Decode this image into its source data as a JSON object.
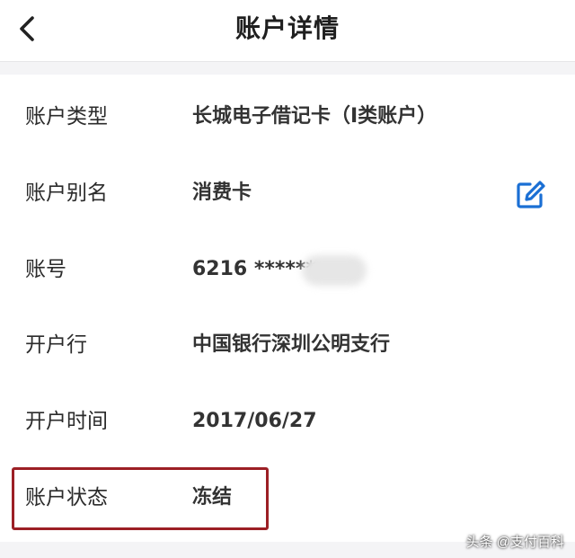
{
  "header": {
    "title": "账户详情",
    "back_icon": "chevron-left-icon"
  },
  "details": {
    "rows": [
      {
        "label": "账户类型",
        "value": "长城电子借记卡（I类账户）"
      },
      {
        "label": "账户别名",
        "value": "消费卡"
      },
      {
        "label": "账号",
        "value": "6216 ******"
      },
      {
        "label": "开户行",
        "value": "中国银行深圳公明支行"
      },
      {
        "label": "开户时间",
        "value": "2017/06/27"
      },
      {
        "label": "账户状态",
        "value": "冻结"
      }
    ],
    "edit_icon": "edit-icon"
  },
  "annotation": {
    "highlight_color": "#9c1f25"
  },
  "watermark": "头条 @支付百科",
  "colors": {
    "accent": "#1a6fd4",
    "text": "#2b2b2b"
  }
}
